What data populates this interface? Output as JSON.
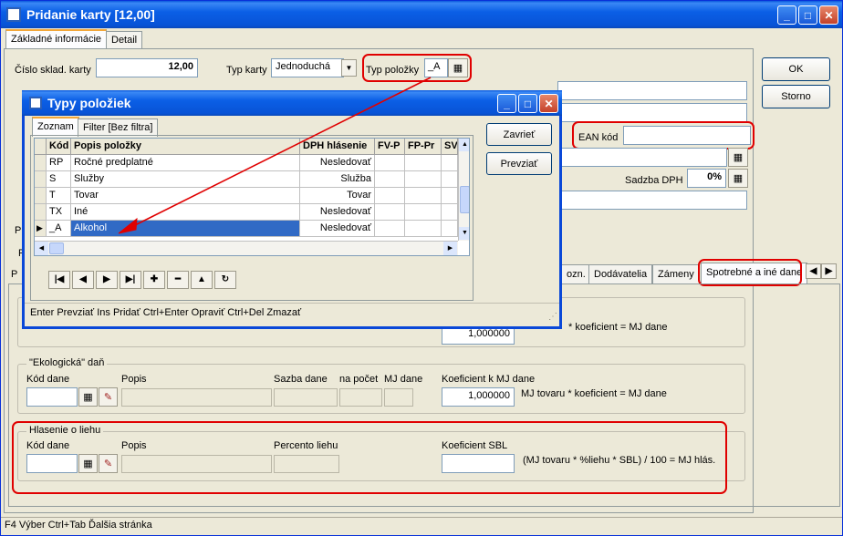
{
  "window": {
    "title": "Pridanie karty [12,00]"
  },
  "main_tabs": [
    "Základné informácie",
    "Detail"
  ],
  "form": {
    "cislo_label": "Číslo sklad. karty",
    "cislo_value": "12,00",
    "typ_karty_label": "Typ karty",
    "typ_karty_value": "Jednoduchá",
    "typ_polozky_label": "Typ položky",
    "typ_polozky_value": "_A",
    "ean_label": "EAN kód",
    "ean_value": "",
    "sadzba_label": "Sadzba DPH",
    "sadzba_value": "0%"
  },
  "buttons": {
    "ok": "OK",
    "storno": "Storno",
    "zavriet": "Zavrieť",
    "prevziat": "Prevziať"
  },
  "bottom_tabs": [
    "ozn.",
    "Dodávatelia",
    "Zámeny",
    "Spotrebné a iné dane"
  ],
  "spotrebna": {
    "sub": "* koeficient = MJ dane",
    "koef_value": "1,000000"
  },
  "ekologicka": {
    "title": "\"Ekologická\" daň",
    "kod_label": "Kód dane",
    "popis_label": "Popis",
    "sadzba_label": "Sazba dane",
    "napocet_label": "na počet",
    "mj_label": "MJ dane",
    "koef_label": "Koeficient k MJ dane",
    "koef_value": "1,000000",
    "formula": "MJ tovaru * koeficient = MJ dane"
  },
  "liehu": {
    "title": "Hlasenie o liehu",
    "kod_label": "Kód dane",
    "popis_label": "Popis",
    "percento_label": "Percento liehu",
    "koef_label": "Koeficient SBL",
    "formula": "(MJ tovaru * %liehu * SBL) / 100 = MJ hlás."
  },
  "status_bar": "F4 Výber Ctrl+Tab Ďalšia stránka",
  "dialog": {
    "title": "Typy položiek",
    "tabs": [
      "Zoznam",
      "Filter [Bez filtra]"
    ],
    "columns": [
      "Kód",
      "Popis položky",
      "DPH hlásenie",
      "FV-P",
      "FP-Pr",
      "SV"
    ],
    "rows": [
      {
        "kod": "RP",
        "popis": "Ročné predplatné",
        "dph": "Nesledovať"
      },
      {
        "kod": "S",
        "popis": "Služby",
        "dph": "Služba"
      },
      {
        "kod": "T",
        "popis": "Tovar",
        "dph": "Tovar"
      },
      {
        "kod": "TX",
        "popis": "Iné",
        "dph": "Nesledovať"
      },
      {
        "kod": "_A",
        "popis": "Alkohol",
        "dph": "Nesledovať"
      }
    ],
    "hint": "Enter Prevziať  Ins Pridať  Ctrl+Enter Opraviť  Ctrl+Del Zmazať"
  },
  "colors": {
    "title_blue": "#0a5ce0",
    "highlight_red": "#e00000",
    "selection": "#316ac5"
  }
}
